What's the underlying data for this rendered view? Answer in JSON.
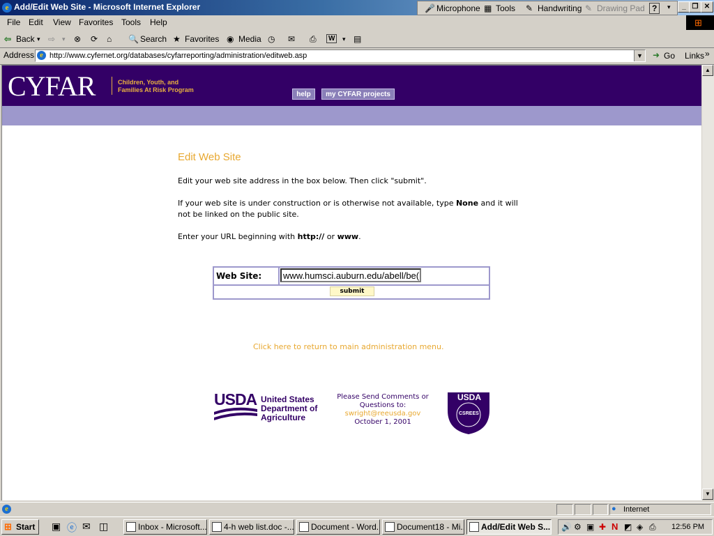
{
  "window": {
    "title": "Add/Edit Web Site - Microsoft Internet Explorer"
  },
  "language_bar": {
    "microphone": "Microphone",
    "tools": "Tools",
    "handwriting": "Handwriting",
    "drawing_pad": "Drawing Pad",
    "help": "?"
  },
  "menu": [
    "File",
    "Edit",
    "View",
    "Favorites",
    "Tools",
    "Help"
  ],
  "toolbar": {
    "back": "Back",
    "search": "Search",
    "favorites": "Favorites",
    "media": "Media"
  },
  "address_bar": {
    "label": "Address",
    "url": "http://www.cyfernet.org/databases/cyfarreporting/administration/editweb.asp",
    "go": "Go",
    "links": "Links"
  },
  "site_header": {
    "logo": "CYFAR",
    "subtitle_line1": "Children, Youth, and",
    "subtitle_line2": "Families At Risk Program",
    "help_button": "help",
    "projects_button": "my CYFAR projects"
  },
  "content": {
    "heading": "Edit Web Site",
    "instruction": "Edit your web site address in the box below. Then click \"submit\".",
    "construction_pre": "If your web site is under construction or is otherwise not available, type ",
    "construction_bold": "None",
    "construction_post": " and it will not be linked on the public site.",
    "url_pre": "Enter your URL beginning with ",
    "url_bold1": "http://",
    "url_mid": " or ",
    "url_bold2": "www",
    "url_post": "."
  },
  "form": {
    "label": "Web Site:",
    "value": "www.humsci.auburn.edu/abell/be(",
    "submit": "submit"
  },
  "return_link": "Click here to return to main administration menu.",
  "footer": {
    "usda": "USDA",
    "usda_line1": "United States",
    "usda_line2": "Department of",
    "usda_line3": "Agriculture",
    "comments_line1": "Please Send Comments or",
    "comments_line2": "Questions to:",
    "email": "swright@reeusda.gov",
    "date": "October 1, 2001",
    "seal_top": "USDA",
    "seal_text": "CSREES"
  },
  "status_bar": {
    "zone": "Internet"
  },
  "taskbar": {
    "start": "Start",
    "tasks": [
      "Inbox - Microsoft...",
      "4-h web list.doc -...",
      "Document - Word...",
      "Document18 - Mi...",
      "Add/Edit Web S..."
    ],
    "clock": "12:56 PM"
  },
  "colors": {
    "header_purple": "#330066",
    "lavender_band": "#9d98cc",
    "gold_text": "#e8a830"
  }
}
